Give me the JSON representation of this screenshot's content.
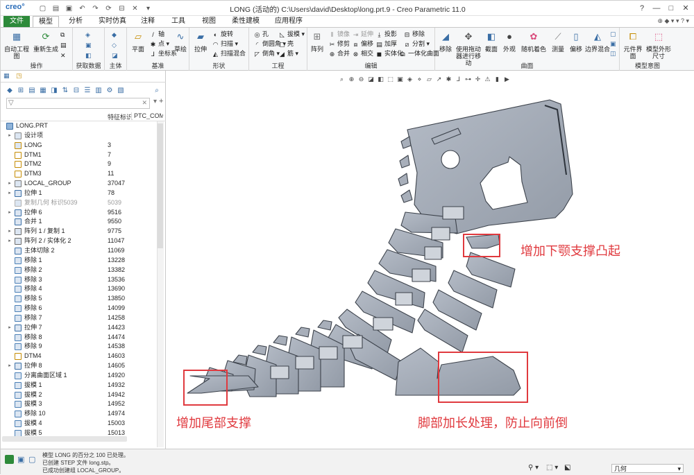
{
  "window": {
    "logo": "creo°",
    "title": "LONG (活动的) C:\\Users\\david\\Desktop\\long.prt.9 - Creo Parametric 11.0"
  },
  "tabs": [
    "文件",
    "模型",
    "分析",
    "实时仿真",
    "注释",
    "工具",
    "视图",
    "柔性建模",
    "应用程序"
  ],
  "ribbon": {
    "groups": [
      "操作",
      "获取数据",
      "主体",
      "基准",
      "形状",
      "工程",
      "编辑",
      "曲面",
      "模型意图"
    ],
    "buttons": {
      "auto_regen": "自动工程图",
      "regenerate": "重新生成",
      "plane": "平面",
      "axis": "轴",
      "point": "点",
      "csys": "坐标系",
      "sketch": "草绘",
      "extrude": "拉伸",
      "revolve": "旋转",
      "sweep": "扫描",
      "swept_blend": "扫描混合",
      "hole": "孔",
      "round": "倒圆角",
      "chamfer": "倒角",
      "draft": "拔模",
      "shell": "壳",
      "rib": "筋",
      "pattern": "阵列",
      "mirror": "镜像",
      "extend": "延伸",
      "trim": "修剪",
      "offset": "偏移",
      "thicken": "加厚",
      "merge": "合并",
      "intersect": "相交",
      "solidify": "实体化",
      "project": "投影",
      "split": "分割",
      "remove": "移除",
      "unify": "一体化曲面",
      "remove2": "移除",
      "drag": "使用拖动器进行移动",
      "section": "截面",
      "appearance": "外观",
      "random_color": "随机着色",
      "measure": "测量",
      "offset2": "偏移",
      "boundary": "边界混合",
      "component_iface": "元件界面",
      "shape_size": "模型外形尺寸"
    }
  },
  "tree": {
    "filter_placeholder": "",
    "col_id": "特征标识",
    "col_ptc": "PTC_COMMON",
    "items": [
      {
        "name": "LONG.PRT",
        "id": "",
        "icon": "part",
        "toggle": false,
        "dim": false,
        "indent": 0
      },
      {
        "name": "设计项",
        "id": "",
        "icon": "folder",
        "toggle": true,
        "dim": false,
        "indent": 1
      },
      {
        "name": "LONG",
        "id": "3",
        "icon": "csys",
        "toggle": false,
        "dim": false,
        "indent": 1
      },
      {
        "name": "DTM1",
        "id": "7",
        "icon": "plane",
        "toggle": false,
        "dim": false,
        "indent": 1
      },
      {
        "name": "DTM2",
        "id": "9",
        "icon": "plane",
        "toggle": false,
        "dim": false,
        "indent": 1
      },
      {
        "name": "DTM3",
        "id": "11",
        "icon": "plane",
        "toggle": false,
        "dim": false,
        "indent": 1
      },
      {
        "name": "LOCAL_GROUP",
        "id": "37047",
        "icon": "group",
        "toggle": true,
        "dim": false,
        "indent": 1
      },
      {
        "name": "拉伸 1",
        "id": "78",
        "icon": "extrude",
        "toggle": true,
        "dim": false,
        "indent": 1
      },
      {
        "name": "复制几何 标识5039",
        "id": "5039",
        "icon": "copy",
        "toggle": false,
        "dim": true,
        "indent": 1
      },
      {
        "name": "拉伸 6",
        "id": "9516",
        "icon": "extrude",
        "toggle": true,
        "dim": false,
        "indent": 1
      },
      {
        "name": "合并 1",
        "id": "9550",
        "icon": "merge",
        "toggle": false,
        "dim": false,
        "indent": 1
      },
      {
        "name": "阵列 1 / 复制 1",
        "id": "9775",
        "icon": "pattern",
        "toggle": true,
        "dim": false,
        "indent": 1
      },
      {
        "name": "阵列 2 / 实体化 2",
        "id": "11047",
        "icon": "pattern",
        "toggle": true,
        "dim": false,
        "indent": 1
      },
      {
        "name": "主体切除 2",
        "id": "11069",
        "icon": "cut",
        "toggle": false,
        "dim": false,
        "indent": 1
      },
      {
        "name": "移除 1",
        "id": "13228",
        "icon": "remove",
        "toggle": false,
        "dim": false,
        "indent": 1
      },
      {
        "name": "移除 2",
        "id": "13382",
        "icon": "remove",
        "toggle": false,
        "dim": false,
        "indent": 1
      },
      {
        "name": "移除 3",
        "id": "13536",
        "icon": "remove",
        "toggle": false,
        "dim": false,
        "indent": 1
      },
      {
        "name": "移除 4",
        "id": "13690",
        "icon": "remove",
        "toggle": false,
        "dim": false,
        "indent": 1
      },
      {
        "name": "移除 5",
        "id": "13850",
        "icon": "remove",
        "toggle": false,
        "dim": false,
        "indent": 1
      },
      {
        "name": "移除 6",
        "id": "14099",
        "icon": "remove",
        "toggle": false,
        "dim": false,
        "indent": 1
      },
      {
        "name": "移除 7",
        "id": "14258",
        "icon": "remove",
        "toggle": false,
        "dim": false,
        "indent": 1
      },
      {
        "name": "拉伸 7",
        "id": "14423",
        "icon": "extrude",
        "toggle": true,
        "dim": false,
        "indent": 1
      },
      {
        "name": "移除 8",
        "id": "14474",
        "icon": "remove",
        "toggle": false,
        "dim": false,
        "indent": 1
      },
      {
        "name": "移除 9",
        "id": "14538",
        "icon": "remove",
        "toggle": false,
        "dim": false,
        "indent": 1
      },
      {
        "name": "DTM4",
        "id": "14603",
        "icon": "plane",
        "toggle": false,
        "dim": false,
        "indent": 1
      },
      {
        "name": "拉伸 8",
        "id": "14605",
        "icon": "extrude",
        "toggle": true,
        "dim": false,
        "indent": 1
      },
      {
        "name": "分离曲面区域 1",
        "id": "14920",
        "icon": "remove",
        "toggle": false,
        "dim": false,
        "indent": 1
      },
      {
        "name": "拔模 1",
        "id": "14932",
        "icon": "draft",
        "toggle": false,
        "dim": false,
        "indent": 1
      },
      {
        "name": "拔模 2",
        "id": "14942",
        "icon": "draft",
        "toggle": false,
        "dim": false,
        "indent": 1
      },
      {
        "name": "拔模 3",
        "id": "14952",
        "icon": "draft",
        "toggle": false,
        "dim": false,
        "indent": 1
      },
      {
        "name": "移除 10",
        "id": "14974",
        "icon": "remove",
        "toggle": false,
        "dim": false,
        "indent": 1
      },
      {
        "name": "拔模 4",
        "id": "15003",
        "icon": "draft",
        "toggle": false,
        "dim": false,
        "indent": 1
      },
      {
        "name": "拔模 5",
        "id": "15013",
        "icon": "draft",
        "toggle": false,
        "dim": false,
        "indent": 1
      }
    ]
  },
  "annotations": {
    "jaw": "增加下颚支撑凸起",
    "tail": "增加尾部支撑",
    "foot": "脚部加长处理，防止向前倒"
  },
  "status": {
    "messages": [
      "模型 LONG 的百分之 100 已处理。",
      "已创建 STEP 文件 long.stp。",
      "已成功创建组 LOCAL_GROUP。"
    ],
    "selection_filter": "几何"
  },
  "colors": {
    "file_tab": "#2d8a3a",
    "model_fill": "#a4acb7",
    "model_edge": "#3c424b",
    "annotation": "#e0393e"
  }
}
